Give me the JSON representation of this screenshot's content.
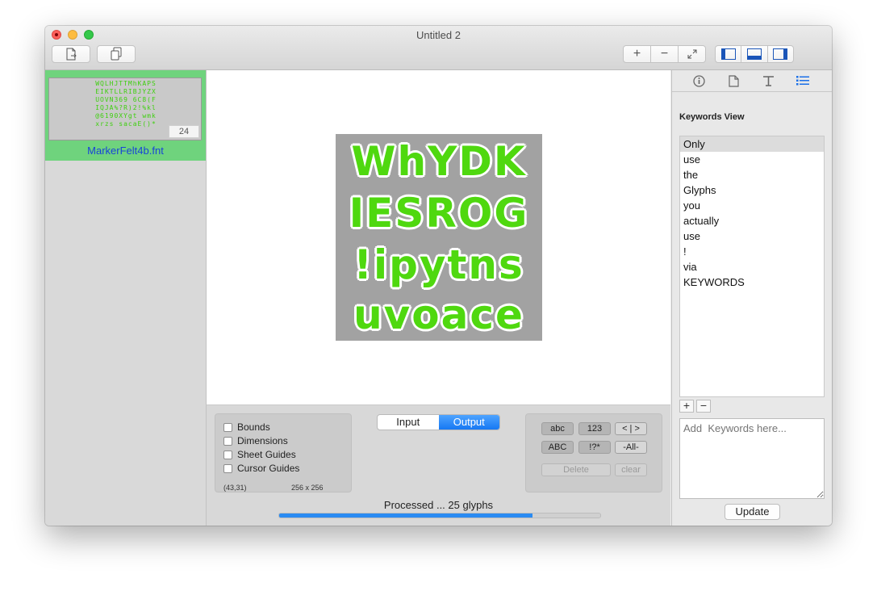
{
  "window": {
    "title": "Untitled 2"
  },
  "toolbar": {
    "new_icon": "new-document-icon",
    "copy_icon": "copy-icon",
    "zoom_in_label": "+",
    "zoom_out_label": "−",
    "fit_icon": "expand-arrows-icon",
    "panels": [
      "left-panel-icon",
      "bottom-panel-icon",
      "right-panel-icon"
    ]
  },
  "sidebar": {
    "items": [
      {
        "file_name": "MarkerFelt4b.fnt",
        "badge": "24",
        "preview_text": "WQLHJTTMhKAPSEIKTLLRIBJYZXUOVN369 6C8(FIQJA%?R)2!%kl@6190XYgt wmkxrzs sacaE()*"
      }
    ]
  },
  "canvas": {
    "glyph_rows": [
      "WhYDK",
      "IESROG",
      "!ipytns",
      "uvoace"
    ]
  },
  "guides": {
    "options": [
      {
        "label": "Bounds",
        "checked": false
      },
      {
        "label": "Dimensions",
        "checked": false
      },
      {
        "label": "Sheet Guides",
        "checked": false
      },
      {
        "label": "Cursor Guides",
        "checked": false
      }
    ],
    "cursor_coords": "(43,31)",
    "sheet_size": "256 x 256"
  },
  "view_mode": {
    "options": [
      "Input",
      "Output"
    ],
    "selected": "Output"
  },
  "filters": {
    "row1": [
      "abc",
      "123",
      "< | >"
    ],
    "row2": [
      "ABC",
      "!?*",
      "-All-"
    ],
    "delete_label": "Delete",
    "clear_label": "clear"
  },
  "status": {
    "text": "Processed ... 25 glyphs",
    "progress": 0.79
  },
  "inspector": {
    "tabs": [
      "info-icon",
      "document-icon",
      "text-icon",
      "list-icon"
    ],
    "selected_tab": "list-icon",
    "title": "Keywords View",
    "keywords": [
      "Only",
      "use",
      "the",
      "Glyphs",
      "you",
      "actually",
      "use",
      "!",
      "via",
      "KEYWORDS"
    ],
    "selected_keyword": "Only",
    "add_label": "+",
    "remove_label": "−",
    "input_placeholder": "Add  Keywords here...",
    "update_label": "Update"
  },
  "colors": {
    "accent": "#1678f3",
    "selection": "#6fd37d",
    "glyph": "#4fd80f",
    "sheet_bg": "#a2a2a2"
  }
}
